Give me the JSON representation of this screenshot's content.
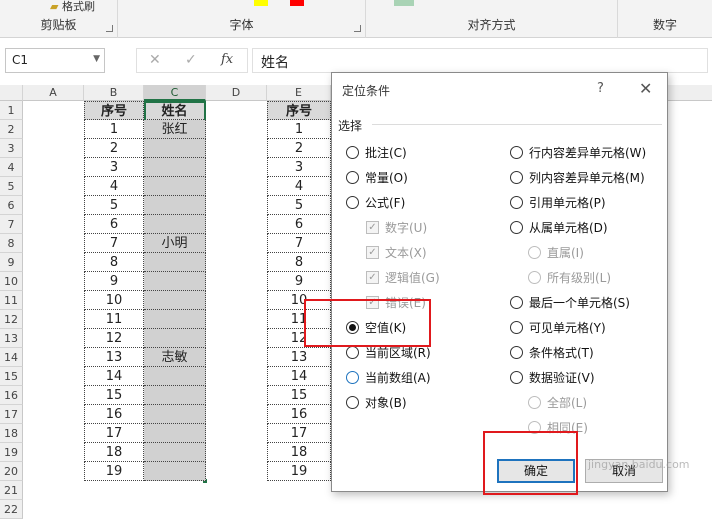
{
  "ribbon": {
    "format_painter": "格式刷",
    "groups": [
      "剪贴板",
      "字体",
      "对齐方式",
      "数字"
    ]
  },
  "formula_bar": {
    "name_box": "C1",
    "cancel_icon": "✕",
    "enter_icon": "✓",
    "fx_icon": "fx",
    "content": "姓名"
  },
  "sheet": {
    "columns_left": [
      "A",
      "B",
      "C",
      "D"
    ],
    "columns_right": [
      "E"
    ],
    "row_numbers": [
      "1",
      "2",
      "3",
      "4",
      "5",
      "6",
      "7",
      "8",
      "9",
      "10",
      "11",
      "12",
      "13",
      "14",
      "15",
      "16",
      "17",
      "18",
      "19",
      "20",
      "21",
      "22"
    ],
    "header_b": "序号",
    "header_c": "姓名",
    "header_e": "序号",
    "seq": [
      "1",
      "2",
      "3",
      "4",
      "5",
      "6",
      "7",
      "8",
      "9",
      "10",
      "11",
      "12",
      "13",
      "14",
      "15",
      "16",
      "17",
      "18",
      "19"
    ],
    "names": [
      "张红",
      "",
      "",
      "",
      "",
      "",
      "小明",
      "",
      "",
      "",
      "",
      "",
      "志敏",
      "",
      "",
      "",
      "",
      "",
      ""
    ]
  },
  "dialog": {
    "title": "定位条件",
    "help": "?",
    "close": "✕",
    "group_label": "选择",
    "left_options": [
      {
        "label": "批注(C)"
      },
      {
        "label": "常量(O)"
      },
      {
        "label": "公式(F)"
      },
      {
        "label": "数字(U)"
      },
      {
        "label": "文本(X)"
      },
      {
        "label": "逻辑值(G)"
      },
      {
        "label": "错误(E)"
      },
      {
        "label": "空值(K)"
      },
      {
        "label": "当前区域(R)"
      },
      {
        "label": "当前数组(A)"
      },
      {
        "label": "对象(B)"
      }
    ],
    "right_options": [
      {
        "label": "行内容差异单元格(W)"
      },
      {
        "label": "列内容差异单元格(M)"
      },
      {
        "label": "引用单元格(P)"
      },
      {
        "label": "从属单元格(D)"
      },
      {
        "label": "直属(I)"
      },
      {
        "label": "所有级别(L)"
      },
      {
        "label": "最后一个单元格(S)"
      },
      {
        "label": "可见单元格(Y)"
      },
      {
        "label": "条件格式(T)"
      },
      {
        "label": "数据验证(V)"
      },
      {
        "label": "全部(L)"
      },
      {
        "label": "相同(E)"
      }
    ],
    "ok": "确定",
    "cancel": "取消",
    "selected": "空值(K)"
  },
  "colors": {
    "accent_green": "#217346",
    "annotation_red": "#e0191d",
    "focus_blue": "#1e73be"
  },
  "watermark": "jingyan.baidu.com"
}
